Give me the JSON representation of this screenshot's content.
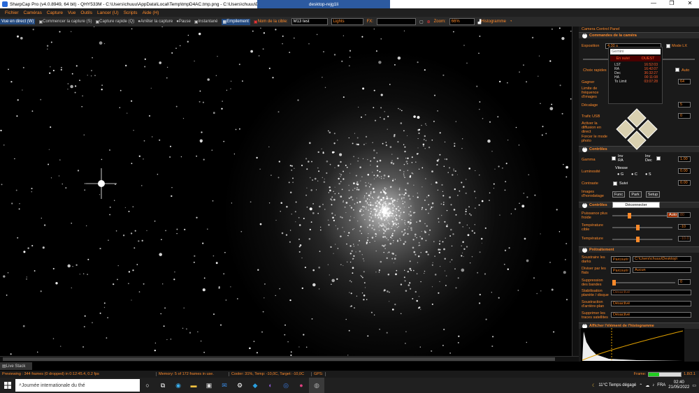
{
  "window": {
    "title": "SharpCap Pro (v4.0.8949, 64 bit) - QHY533M - C:\\Users\\chuuu\\AppData\\Local\\Temp\\tmpD4AC.tmp.png - C:\\Users\\chuuu\\Desk",
    "remote_title": "desktop-rejg1li",
    "min": "—",
    "max": "❐",
    "close": "✕"
  },
  "menu": [
    "Fichier",
    "Caméras",
    "Capture",
    "Vue",
    "Outils",
    "Lancer (U)",
    "Scripts",
    "Aide (H)"
  ],
  "toolbar": {
    "live": "Vue en direct (W)",
    "start": "Commencer la capture (S)",
    "quick": "Capture rapide (Q)",
    "stop": "Arrêter la capture",
    "pause": "Pause",
    "snapshot": "Instantané",
    "stack": "Empilement",
    "target_label": "Nom de la cible:",
    "target_value": "M13 test",
    "frame_type": "Lights",
    "fx_label": "FX:",
    "zoom_label": "Zoom:",
    "zoom_value": "66%",
    "histogram": "Histogramme"
  },
  "live_stack_tab": "Live Stack",
  "status": {
    "previewing": "Previewing : 344 frames (0 dropped) in 0:12:45.4, 0.2 fps",
    "memory": "Memory: 5 of 172 frames in use.",
    "cooler": "Cooler: 31%, Temp: -10,0C, Target: -10,0C",
    "gps": "GPS:",
    "frame_label": "Frame:",
    "frame_value": "1.8/2.1",
    "frame_progress": 0.32
  },
  "panel": {
    "title": "Camera Control Panel",
    "sections": {
      "camera": "Commandes de la caméra",
      "mount": "Contrôles",
      "thermal": "Contrôles",
      "preprocess": "Prétraitement",
      "histogram": "Afficher l'élément de l'histogramme"
    },
    "exposure_label": "Exposition",
    "exposure_value": "4.00 s",
    "lx_mode": "Mode LX",
    "quick_choice": "Choix rapides",
    "auto": "Auto",
    "gain_label": "Gagner",
    "gain_value": "64",
    "frame_rate_limit": "Limite de fréquence d'images",
    "offset_label": "Décalage",
    "offset_value": "5",
    "usb_label": "Trafic USB",
    "usb_value": "0",
    "direct_broadcast": "Activer la diffusion en direct",
    "force_photo": "Forcer le mode photo",
    "gamma_label": "Gamma",
    "gamma_value": "1.00",
    "brightness_label": "Luminosité",
    "brightness_value": "0.00",
    "contrast_label": "Contraste",
    "contrast_value": "0.00",
    "timestamp_label": "Images d'horodatage",
    "inv_ra": "Inv RA",
    "inv_dec": "Inv Dec",
    "speed_label": "Vitesse",
    "speed_options": [
      "G",
      "C",
      "S"
    ],
    "track": "Suivi",
    "func": "Func",
    "park": "Park",
    "setup": "Setup",
    "disconnect": "Déconnecter",
    "cooling_power_label": "Puissance plus froide",
    "cooling_auto": "Auto",
    "cooling_value": "80",
    "target_temp_label": "Température cible",
    "target_temp_value": "-10",
    "temp_label": "Température",
    "temp_value": "-10.0",
    "dark_label": "Soustraire les darks",
    "browse": "Parcourir",
    "dark_path": "C:\\Users\\chuuu\\Desktop\\",
    "flat_label": "Diviser par les flats",
    "flat_value": "Aucun",
    "banding_label": "Suppression des bandes",
    "banding_value": "0",
    "stabilize_label": "Stabilisation planète / disque",
    "disabled": "Désactivé",
    "bgsub_label": "Soustraction d'arrière-plan",
    "satellite_label": "Supprimer les traces satellites"
  },
  "gemini": {
    "device": "Gemini",
    "state": "En suivi",
    "side": "OUEST",
    "rows": [
      {
        "k": "LST",
        "v": "16:52:03"
      },
      {
        "k": "RA",
        "v": "16:42:07"
      },
      {
        "k": "Dec",
        "v": "36:32:27"
      },
      {
        "k": "HA",
        "v": "00:11:08"
      },
      {
        "k": "To Limit",
        "v": "03:07:28"
      }
    ]
  },
  "taskbar": {
    "search": "Journée internationale du thé",
    "weather": "11°C  Temps dégagé",
    "lang": "FRA",
    "time": "02:40",
    "date": "21/05/2022"
  }
}
